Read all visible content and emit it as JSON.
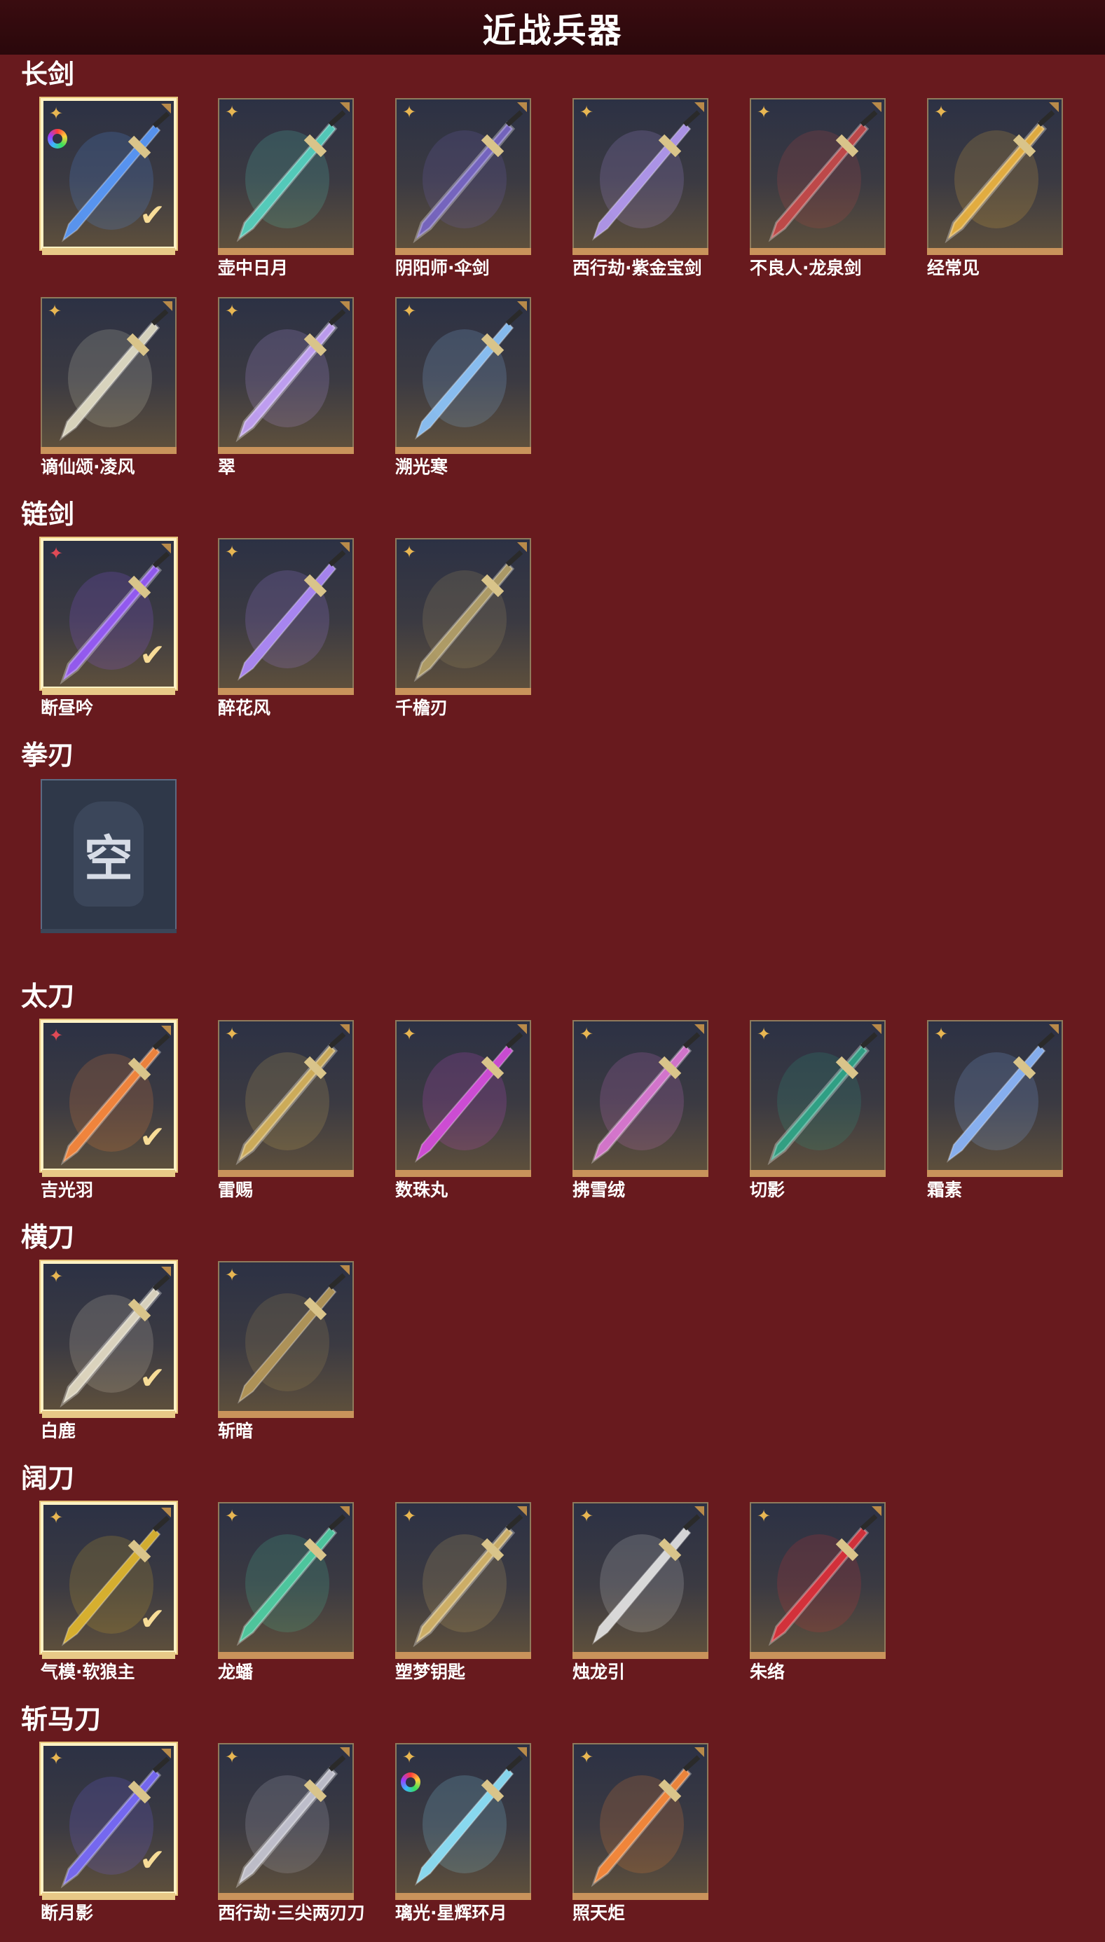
{
  "page_title": "近战兵器",
  "empty_slot_label": "空",
  "categories": [
    {
      "name": "长剑",
      "weapons": [
        {
          "name": "",
          "rarity": "gold",
          "equipped": true,
          "dye": true,
          "color": "#5a9cff"
        },
        {
          "name": "壶中日月",
          "rarity": "gold",
          "equipped": false,
          "dye": false,
          "color": "#56d6c4"
        },
        {
          "name": "阴阳师·伞剑",
          "rarity": "gold",
          "equipped": false,
          "dye": false,
          "color": "#7a68c9"
        },
        {
          "name": "西行劫·紫金宝剑",
          "rarity": "gold",
          "equipped": false,
          "dye": false,
          "color": "#b69cf5"
        },
        {
          "name": "不良人·龙泉剑",
          "rarity": "gold",
          "equipped": false,
          "dye": false,
          "color": "#c94a4a"
        },
        {
          "name": "经常见",
          "rarity": "gold",
          "equipped": false,
          "dye": false,
          "color": "#f0b640"
        }
      ]
    },
    {
      "name": "",
      "weapons": [
        {
          "name": "谪仙颂·凌风",
          "rarity": "gold",
          "equipped": false,
          "dye": false,
          "color": "#e6e1c8"
        },
        {
          "name": "翠",
          "rarity": "gold",
          "equipped": false,
          "dye": false,
          "color": "#c9a6ff"
        },
        {
          "name": "溯光寒",
          "rarity": "gold",
          "equipped": false,
          "dye": false,
          "color": "#8fc8ff"
        }
      ]
    },
    {
      "name": "链剑",
      "weapons": [
        {
          "name": "断昼吟",
          "rarity": "red",
          "equipped": true,
          "dye": false,
          "color": "#9a5cff"
        },
        {
          "name": "醉花风",
          "rarity": "gold",
          "equipped": false,
          "dye": false,
          "color": "#b18cff"
        },
        {
          "name": "千檐刃",
          "rarity": "gold",
          "equipped": false,
          "dye": false,
          "color": "#b7a36a"
        }
      ]
    },
    {
      "name": "拳刃",
      "weapons": [
        {
          "name": "",
          "rarity": "",
          "equipped": false,
          "dye": false,
          "color": "",
          "empty": true
        }
      ]
    },
    {
      "name": "太刀",
      "weapons": [
        {
          "name": "吉光羽",
          "rarity": "red",
          "equipped": true,
          "dye": false,
          "color": "#ff8a3c"
        },
        {
          "name": "雷赐",
          "rarity": "gold",
          "equipped": false,
          "dye": false,
          "color": "#d9b55c"
        },
        {
          "name": "数珠丸",
          "rarity": "gold",
          "equipped": false,
          "dye": false,
          "color": "#d94ee0"
        },
        {
          "name": "拂雪绒",
          "rarity": "gold",
          "equipped": false,
          "dye": false,
          "color": "#e07ad8"
        },
        {
          "name": "切影",
          "rarity": "gold",
          "equipped": false,
          "dye": false,
          "color": "#2fa98a"
        },
        {
          "name": "霜素",
          "rarity": "gold",
          "equipped": false,
          "dye": false,
          "color": "#8db9ff"
        }
      ]
    },
    {
      "name": "横刀",
      "weapons": [
        {
          "name": "白鹿",
          "rarity": "gold",
          "equipped": true,
          "dye": false,
          "color": "#e8e0c8"
        },
        {
          "name": "斩暗",
          "rarity": "gold",
          "equipped": false,
          "dye": false,
          "color": "#b89a5a"
        }
      ]
    },
    {
      "name": "阔刀",
      "weapons": [
        {
          "name": "气模·软狼主",
          "rarity": "gold",
          "equipped": true,
          "dye": false,
          "color": "#e3b92e"
        },
        {
          "name": "龙蟠",
          "rarity": "gold",
          "equipped": false,
          "dye": false,
          "color": "#4fd2a6"
        },
        {
          "name": "塑梦钥匙",
          "rarity": "gold",
          "equipped": false,
          "dye": false,
          "color": "#d9b86a"
        },
        {
          "name": "烛龙引",
          "rarity": "gold",
          "equipped": false,
          "dye": false,
          "color": "#e6e6e6"
        },
        {
          "name": "朱络",
          "rarity": "gold",
          "equipped": false,
          "dye": false,
          "color": "#e0303a"
        }
      ]
    },
    {
      "name": "斩马刀",
      "weapons": [
        {
          "name": "断月影",
          "rarity": "gold",
          "equipped": true,
          "dye": false,
          "color": "#7a6cff"
        },
        {
          "name": "西行劫·三尖两刃刀",
          "rarity": "gold",
          "equipped": false,
          "dye": false,
          "color": "#c9c9d6"
        },
        {
          "name": "璃光·星辉环月",
          "rarity": "gold",
          "equipped": false,
          "dye": true,
          "color": "#8fe6ff"
        },
        {
          "name": "照天炬",
          "rarity": "gold",
          "equipped": false,
          "dye": false,
          "color": "#ff8c3a"
        }
      ]
    }
  ]
}
